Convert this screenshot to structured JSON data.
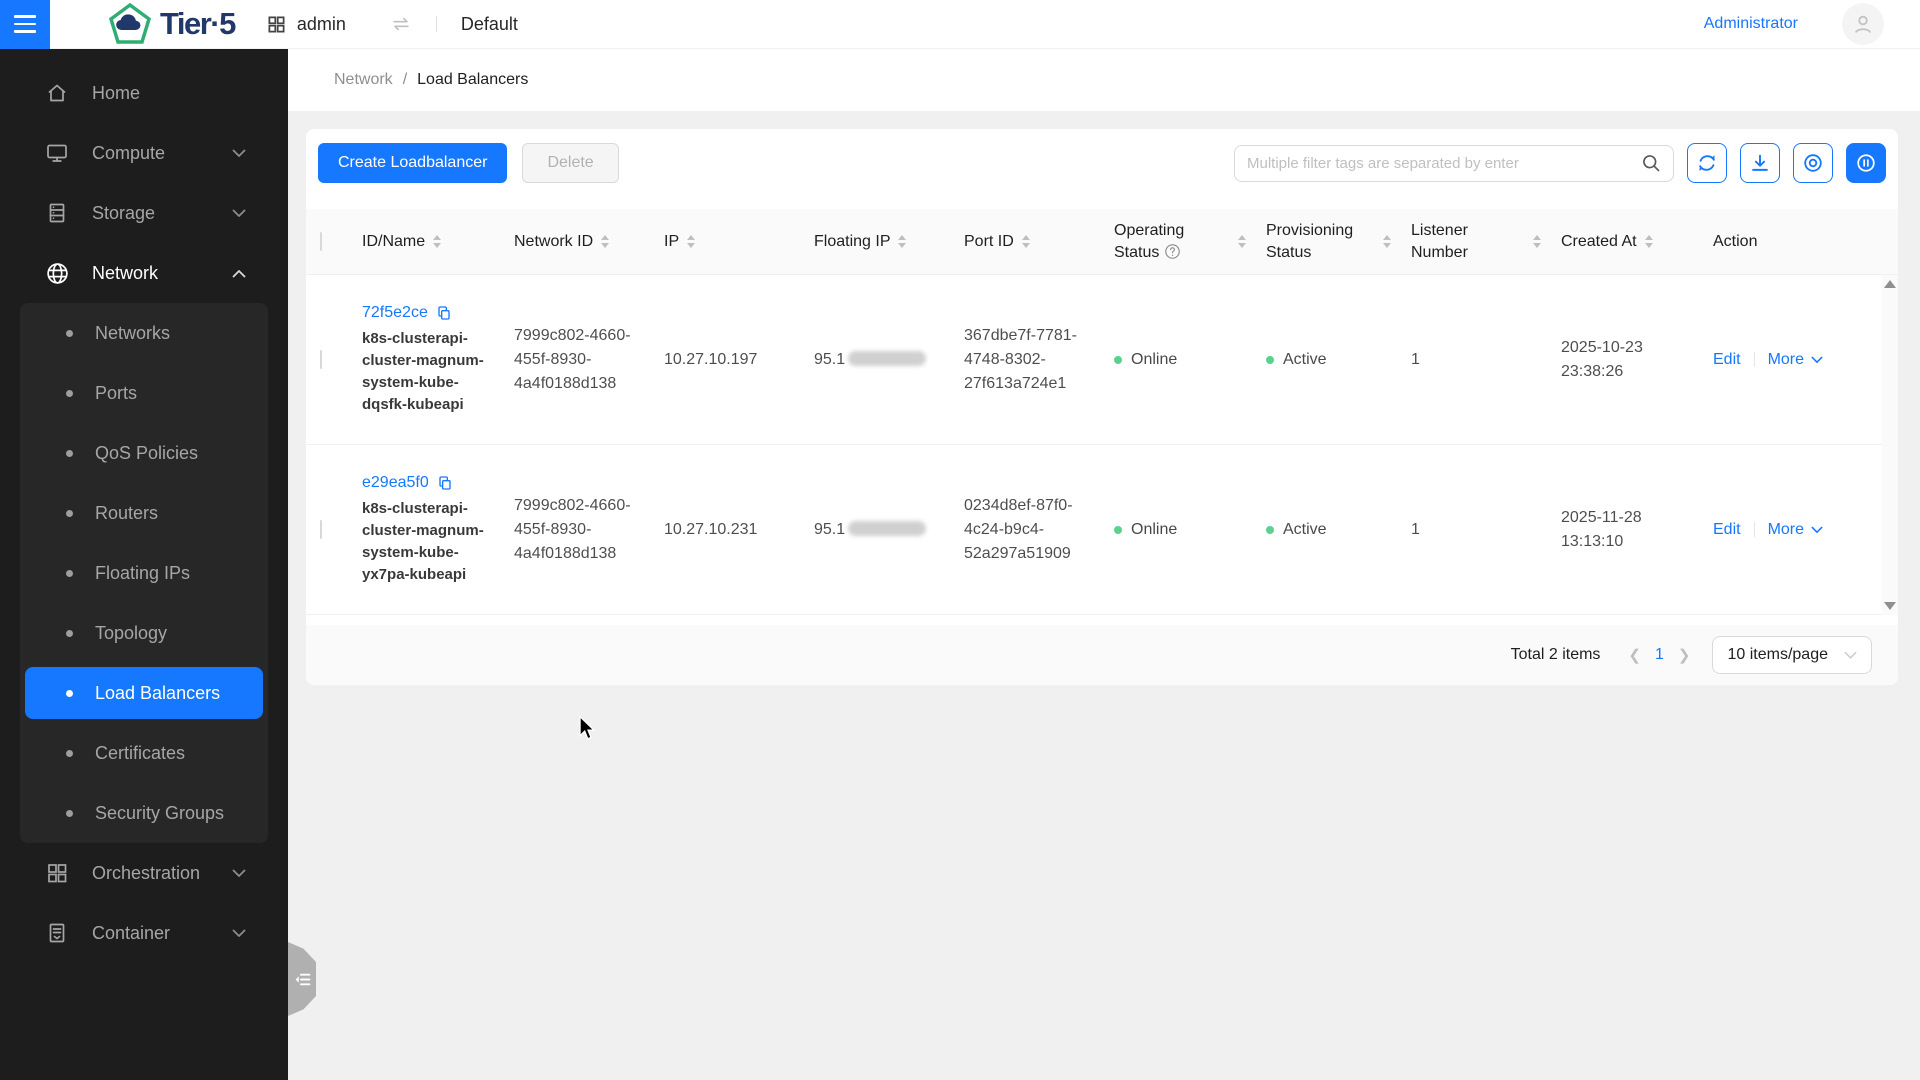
{
  "topbar": {
    "brand": "Tier·5",
    "project": "admin",
    "domain": "Default",
    "user": "Administrator"
  },
  "sidebar": {
    "items": [
      {
        "label": "Home",
        "icon": "home-icon"
      },
      {
        "label": "Compute",
        "icon": "monitor-icon",
        "expandable": true
      },
      {
        "label": "Storage",
        "icon": "storage-icon",
        "expandable": true
      },
      {
        "label": "Network",
        "icon": "globe-icon",
        "expanded": true,
        "active_child": "Load Balancers",
        "children": [
          "Networks",
          "Ports",
          "QoS Policies",
          "Routers",
          "Floating IPs",
          "Topology",
          "Load Balancers",
          "Certificates",
          "Security Groups"
        ]
      },
      {
        "label": "Orchestration",
        "icon": "grid-icon",
        "expandable": true
      },
      {
        "label": "Container",
        "icon": "document-icon",
        "expandable": true
      }
    ]
  },
  "breadcrumb": {
    "parent": "Network",
    "separator": "/",
    "current": "Load Balancers"
  },
  "toolbar": {
    "create_label": "Create Loadbalancer",
    "delete_label": "Delete",
    "search_placeholder": "Multiple filter tags are separated by enter"
  },
  "table": {
    "columns": [
      "ID/Name",
      "Network ID",
      "IP",
      "Floating IP",
      "Port ID",
      "Operating Status",
      "Provisioning Status",
      "Listener Number",
      "Created At",
      "Action"
    ],
    "actions": {
      "edit": "Edit",
      "more": "More"
    },
    "rows": [
      {
        "id": "72f5e2ce",
        "name": "k8s-clusterapi-cluster-magnum-system-kube-dqsfk-kubeapi",
        "network_id": "7999c802-4660-455f-8930-4a4f0188d138",
        "ip": "10.27.10.197",
        "floating_ip_visible": "95.1",
        "port_id": "367dbe7f-7781-4748-8302-27f613a724e1",
        "operating_status": "Online",
        "provisioning_status": "Active",
        "listener_number": "1",
        "created_at": "2025-10-23 23:38:26"
      },
      {
        "id": "e29ea5f0",
        "name": "k8s-clusterapi-cluster-magnum-system-kube-yx7pa-kubeapi",
        "network_id": "7999c802-4660-455f-8930-4a4f0188d138",
        "ip": "10.27.10.231",
        "floating_ip_visible": "95.1",
        "port_id": "0234d8ef-87f0-4c24-b9c4-52a297a51909",
        "operating_status": "Online",
        "provisioning_status": "Active",
        "listener_number": "1",
        "created_at": "2025-11-28 13:13:10"
      }
    ]
  },
  "pagination": {
    "total_label": "Total 2 items",
    "current_page": "1",
    "page_size": "10 items/page"
  },
  "colors": {
    "primary": "#1677ff",
    "success_dot": "#5ad18f",
    "sidebar_bg": "#1d1d1d",
    "submenu_bg": "#272727",
    "brand_navy": "#21386b",
    "brand_green": "#2fae74",
    "header_bg": "#fafafa"
  },
  "icons": {
    "toolbar": [
      "search-icon",
      "refresh-icon",
      "download-icon",
      "watch-icon",
      "pause-icon"
    ],
    "row": [
      "copy-icon",
      "help-icon",
      "sort-caret-icon",
      "chevron-down-icon"
    ]
  }
}
